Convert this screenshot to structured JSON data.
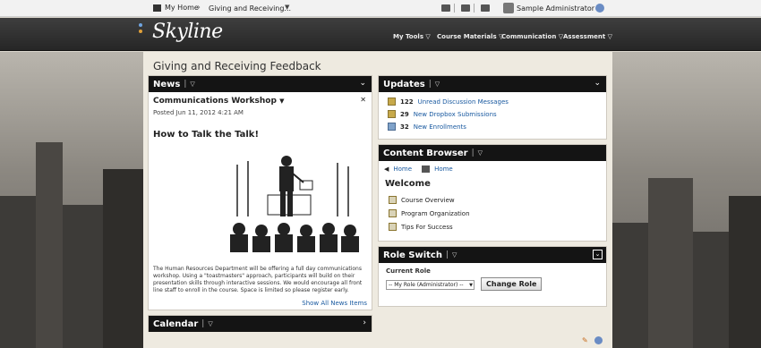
{
  "topbar": {
    "my_home": "My Home",
    "course_name": "Giving and Receiving...",
    "user_name": "Sample Administrator"
  },
  "header": {
    "logo": "Skyline",
    "nav": [
      "My Tools",
      "Course Materials",
      "Communication",
      "Assessment"
    ]
  },
  "page": {
    "title": "Giving and Receiving Feedback"
  },
  "news": {
    "title": "News",
    "item_title": "Communications Workshop",
    "posted": "Posted Jun 11, 2012 4:21 AM",
    "heading": "How to Talk the Talk!",
    "body": "The Human Resources Department will be offering a full day communications workshop. Using a \"toastmasters\" approach, participants will build on their presentation skills through interactive sessions. We would encourage all front line staff to enroll in the course. Space is limited so please register early.",
    "show_all": "Show All News Items"
  },
  "calendar": {
    "title": "Calendar"
  },
  "updates": {
    "title": "Updates",
    "items": [
      {
        "count": "122",
        "label": "Unread Discussion Messages"
      },
      {
        "count": "29",
        "label": "New Dropbox Submissions"
      },
      {
        "count": "32",
        "label": "New Enrollments"
      }
    ]
  },
  "content_browser": {
    "title": "Content Browser",
    "crumb_home_1": "Home",
    "crumb_home_2": "Home",
    "welcome": "Welcome",
    "items": [
      "Course Overview",
      "Program Organization",
      "Tips For Success"
    ]
  },
  "role_switch": {
    "title": "Role Switch",
    "current_role_label": "Current Role",
    "select_value": "-- My Role (Administrator) --",
    "button": "Change Role"
  },
  "colors": {
    "header": "#2f2f2f",
    "widget_head": "#141414",
    "link": "#1a5aa0"
  }
}
